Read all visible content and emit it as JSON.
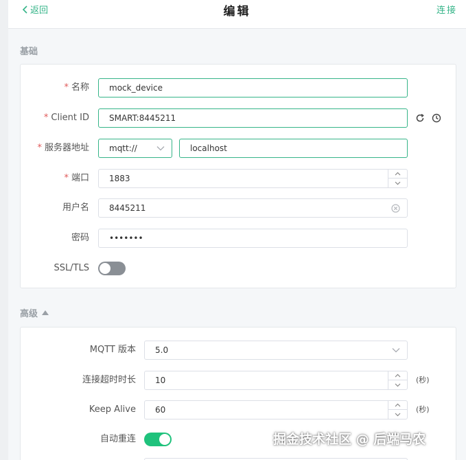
{
  "header": {
    "back_label": "返回",
    "title": "编辑",
    "connect_label": "连接"
  },
  "basic": {
    "section_title": "基础",
    "name": {
      "label": "名称",
      "value": "mock_device"
    },
    "client_id": {
      "label": "Client ID",
      "value": "SMART:8445211"
    },
    "server": {
      "label": "服务器地址",
      "protocol": "mqtt://",
      "host": "localhost"
    },
    "port": {
      "label": "端口",
      "value": "1883"
    },
    "username": {
      "label": "用户名",
      "value": "8445211"
    },
    "password": {
      "label": "密码",
      "value": "•••••••"
    },
    "ssl": {
      "label": "SSL/TLS",
      "enabled": false
    }
  },
  "advanced": {
    "section_title": "高级",
    "mqtt_version": {
      "label": "MQTT 版本",
      "value": "5.0"
    },
    "connect_timeout": {
      "label": "连接超时时长",
      "value": "10",
      "unit": "(秒)"
    },
    "keep_alive": {
      "label": "Keep Alive",
      "value": "60",
      "unit": "(秒)"
    },
    "auto_reconnect": {
      "label": "自动重连",
      "enabled": true
    }
  },
  "watermark": "掘金技术社区 @ 后端马农",
  "colors": {
    "accent": "#35b488",
    "required": "#e05a5a",
    "toggle_on": "#1fc27c",
    "toggle_off": "#8a8f95"
  },
  "icons": [
    "chevron-left-icon",
    "refresh-icon",
    "clock-icon",
    "chevron-down-icon",
    "clear-icon",
    "caret-up-icon",
    "chevron-up-icon"
  ]
}
